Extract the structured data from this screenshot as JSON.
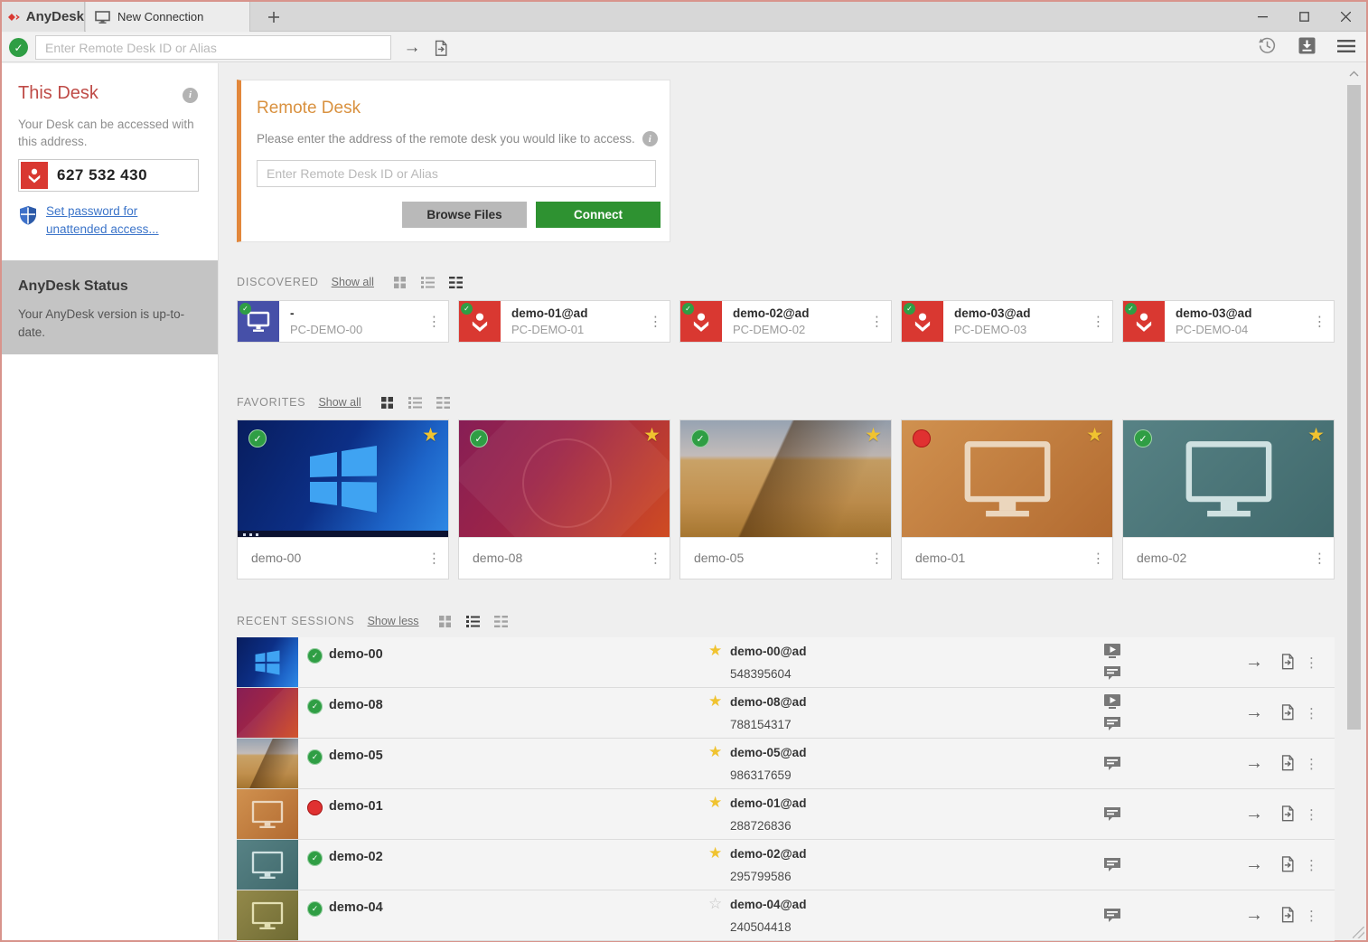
{
  "window": {
    "app_name": "AnyDesk",
    "tab_title": "New Connection"
  },
  "toolbar": {
    "address_placeholder": "Enter Remote Desk ID or Alias"
  },
  "sidebar": {
    "this_desk_title": "This Desk",
    "this_desk_description": "Your Desk can be accessed with this address.",
    "desk_address": "627 532 430",
    "password_link": "Set password for unattended access...",
    "status_title": "AnyDesk Status",
    "status_message": "Your AnyDesk version is up-to-date."
  },
  "remote_desk": {
    "title": "Remote Desk",
    "description": "Please enter the address of the remote desk you would like to access.",
    "input_placeholder": "Enter Remote Desk ID or Alias",
    "browse_files_label": "Browse Files",
    "connect_label": "Connect"
  },
  "discovered": {
    "label": "DISCOVERED",
    "show_link": "Show all",
    "tiles": [
      {
        "title": "-",
        "subtitle": "PC-DEMO-00",
        "status": "online"
      },
      {
        "title": "demo-01@ad",
        "subtitle": "PC-DEMO-01",
        "status": "online"
      },
      {
        "title": "demo-02@ad",
        "subtitle": "PC-DEMO-02",
        "status": "online"
      },
      {
        "title": "demo-03@ad",
        "subtitle": "PC-DEMO-03",
        "status": "online"
      },
      {
        "title": "demo-03@ad",
        "subtitle": "PC-DEMO-04",
        "status": "online"
      }
    ]
  },
  "favorites": {
    "label": "FAVORITES",
    "show_link": "Show all",
    "tiles": [
      {
        "name": "demo-00",
        "status": "online",
        "favorite": true
      },
      {
        "name": "demo-08",
        "status": "online",
        "favorite": true
      },
      {
        "name": "demo-05",
        "status": "online",
        "favorite": true
      },
      {
        "name": "demo-01",
        "status": "offline",
        "favorite": true
      },
      {
        "name": "demo-02",
        "status": "online",
        "favorite": true
      }
    ]
  },
  "recent_sessions": {
    "label": "RECENT SESSIONS",
    "show_link": "Show less",
    "rows": [
      {
        "name": "demo-00",
        "alias": "demo-00@ad",
        "id": "548395604",
        "status": "online",
        "favorite": true,
        "has_recording": true,
        "has_chat": true
      },
      {
        "name": "demo-08",
        "alias": "demo-08@ad",
        "id": "788154317",
        "status": "online",
        "favorite": true,
        "has_recording": true,
        "has_chat": true
      },
      {
        "name": "demo-05",
        "alias": "demo-05@ad",
        "id": "986317659",
        "status": "online",
        "favorite": true,
        "has_recording": false,
        "has_chat": true
      },
      {
        "name": "demo-01",
        "alias": "demo-01@ad",
        "id": "288726836",
        "status": "offline",
        "favorite": true,
        "has_recording": false,
        "has_chat": true
      },
      {
        "name": "demo-02",
        "alias": "demo-02@ad",
        "id": "295799586",
        "status": "online",
        "favorite": true,
        "has_recording": false,
        "has_chat": true
      },
      {
        "name": "demo-04",
        "alias": "demo-04@ad",
        "id": "240504418",
        "status": "online",
        "favorite": false,
        "has_recording": false,
        "has_chat": true
      }
    ]
  },
  "colors": {
    "anydesk_red": "#d93831",
    "accent_orange": "#e2873b",
    "connect_green": "#2e9231",
    "online_green": "#2f9e44",
    "offline_red": "#e03131",
    "link_blue": "#3b74c9",
    "star_yellow": "#f0c330"
  }
}
